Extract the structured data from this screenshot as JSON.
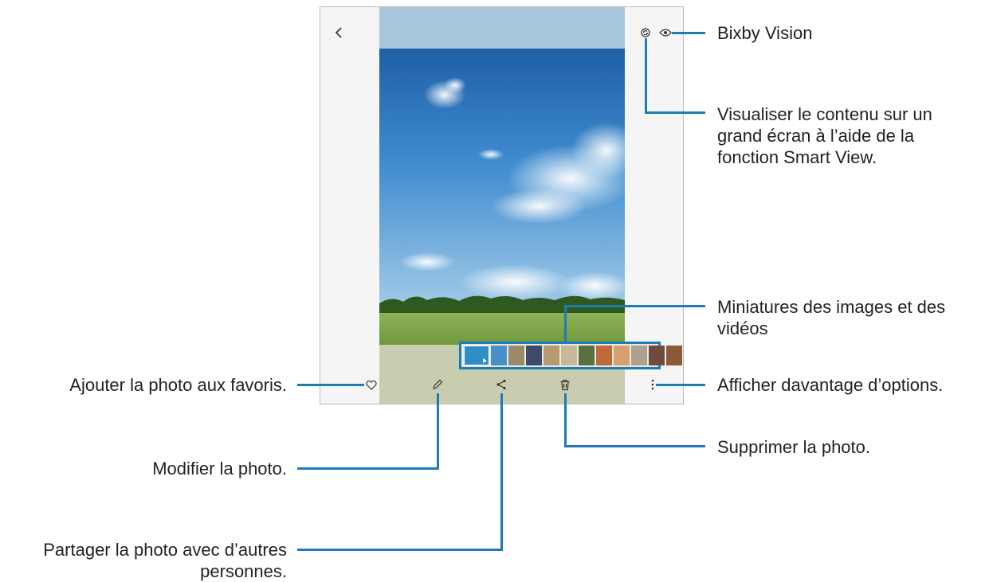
{
  "annotations": {
    "bixby_vision": "Bixby Vision",
    "smart_view": [
      "Visualiser le contenu sur un",
      "grand écran à l’aide de la",
      "fonction Smart View."
    ],
    "thumbnails": [
      "Miniatures des images et des",
      "vidéos"
    ],
    "more_options": "Afficher davantage d’options.",
    "favorite": "Ajouter la photo aux favoris.",
    "edit": "Modifier la photo.",
    "delete": "Supprimer la photo.",
    "share": [
      "Partager la photo avec d’autres",
      "personnes."
    ]
  },
  "colors": {
    "callout_line": "#1f7bb4",
    "sky_top": "#a8c6dc",
    "sky": "#3f8ccf",
    "grass": "#7ea449"
  },
  "icons": {
    "back": "chevron-left-icon",
    "smart_view": "smart-view-icon",
    "bixby_vision": "eye-icon",
    "favorite": "heart-icon",
    "edit": "pencil-icon",
    "share": "share-icon",
    "delete": "trash-icon",
    "more": "more-vertical-icon"
  },
  "thumbnail_colors": [
    "#2f8fc4",
    "#4a90c8",
    "#9a8a6a",
    "#3d4a6a",
    "#b89a70",
    "#c8b89a",
    "#5a7040",
    "#c06a3a",
    "#d8a070",
    "#b0a090",
    "#704a3a",
    "#8a5a3a"
  ]
}
